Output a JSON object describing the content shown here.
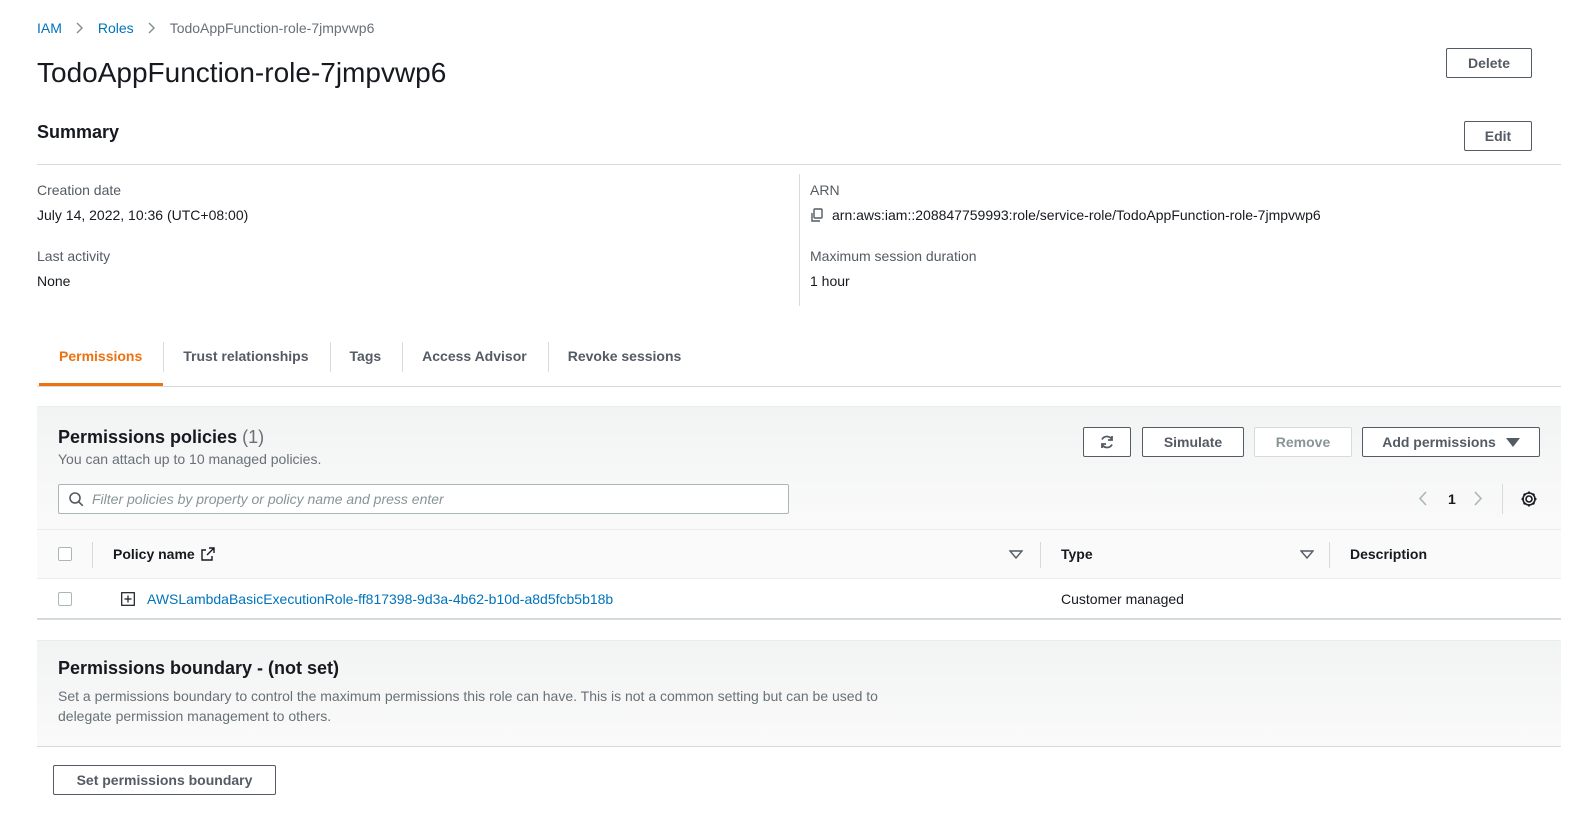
{
  "breadcrumb": {
    "items": [
      "IAM",
      "Roles"
    ],
    "current": "TodoAppFunction-role-7jmpvwp6"
  },
  "page": {
    "title": "TodoAppFunction-role-7jmpvwp6",
    "delete_label": "Delete"
  },
  "summary": {
    "title": "Summary",
    "edit_label": "Edit",
    "creation_date_label": "Creation date",
    "creation_date_value": "July 14, 2022, 10:36 (UTC+08:00)",
    "last_activity_label": "Last activity",
    "last_activity_value": "None",
    "arn_label": "ARN",
    "arn_value": "arn:aws:iam::208847759993:role/service-role/TodoAppFunction-role-7jmpvwp6",
    "max_session_label": "Maximum session duration",
    "max_session_value": "1 hour"
  },
  "tabs": [
    "Permissions",
    "Trust relationships",
    "Tags",
    "Access Advisor",
    "Revoke sessions"
  ],
  "permissions": {
    "title": "Permissions policies",
    "count": "(1)",
    "description": "You can attach up to 10 managed policies.",
    "simulate_label": "Simulate",
    "remove_label": "Remove",
    "add_label": "Add permissions",
    "filter_placeholder": "Filter policies by property or policy name and press enter",
    "page_number": "1",
    "columns": {
      "policy_name": "Policy name",
      "type": "Type",
      "description": "Description"
    },
    "rows": [
      {
        "policy_name": "AWSLambdaBasicExecutionRole-ff817398-9d3a-4b62-b10d-a8d5fcb5b18b",
        "type": "Customer managed",
        "description": ""
      }
    ]
  },
  "boundary": {
    "title": "Permissions boundary - (not set)",
    "description_line1": "Set a permissions boundary to control the maximum permissions this role can have. This is not a common setting but can be used to",
    "description_line2": "delegate permission management to others.",
    "button_label": "Set permissions boundary"
  },
  "colors": {
    "link": "#0073bb",
    "active_tab": "#ec7211",
    "border": "#d5dbdb",
    "text": "#16191f",
    "muted": "#687078"
  },
  "icons": [
    "chevron-right-icon",
    "copy-icon",
    "refresh-icon",
    "caret-down-icon",
    "search-icon",
    "chevron-left-icon",
    "gear-icon",
    "external-link-icon",
    "sort-icon",
    "expand-icon"
  ]
}
